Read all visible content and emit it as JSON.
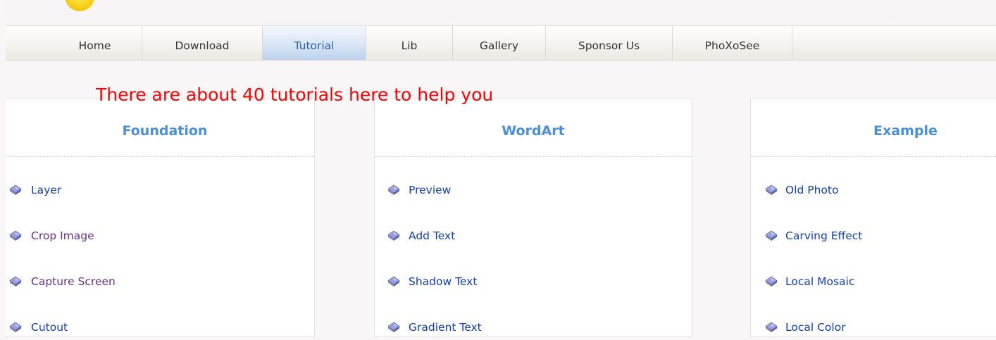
{
  "nav": {
    "items": [
      {
        "label": "Home"
      },
      {
        "label": "Download"
      },
      {
        "label": "Tutorial"
      },
      {
        "label": "Lib"
      },
      {
        "label": "Gallery"
      },
      {
        "label": "Sponsor Us"
      },
      {
        "label": "PhoXoSee"
      }
    ],
    "active": "Tutorial"
  },
  "headline": "There are about 40 tutorials here to help you",
  "columns": [
    {
      "title": "Foundation",
      "items": [
        "Layer",
        "Crop Image",
        "Capture Screen",
        "Cutout"
      ]
    },
    {
      "title": "WordArt",
      "items": [
        "Preview",
        "Add Text",
        "Shadow Text",
        "Gradient Text"
      ]
    },
    {
      "title": "Example",
      "items": [
        "Old Photo",
        "Carving Effect",
        "Local Mosaic",
        "Local Color"
      ]
    }
  ],
  "colors": {
    "headline": "#ff0000",
    "column_title": "#4a90d8",
    "link": "#0f3fb2",
    "visited_link": "#6b2f8a",
    "active_tab": "#bcd2ee"
  },
  "icons": {
    "logo": "sun-logo-icon",
    "bullet": "diamond-bullet-icon"
  }
}
